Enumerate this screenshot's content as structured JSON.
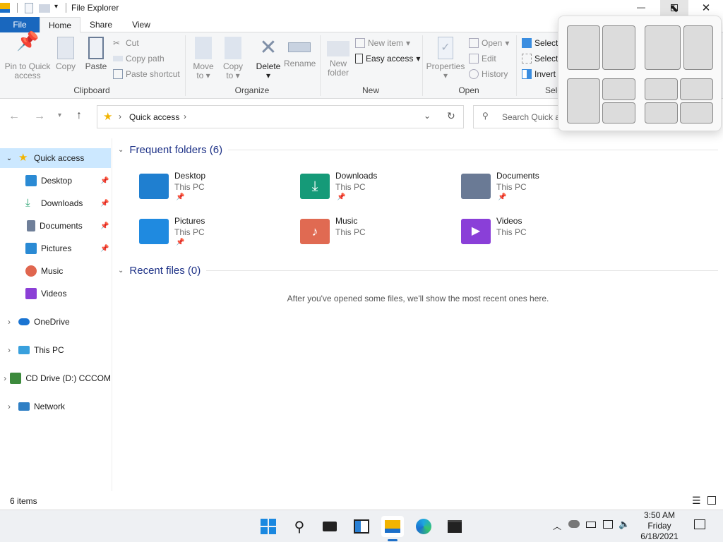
{
  "window": {
    "title": "File Explorer"
  },
  "tabs": {
    "file": "File",
    "home": "Home",
    "share": "Share",
    "view": "View"
  },
  "ribbon": {
    "clipboard": {
      "label": "Clipboard",
      "pin": "Pin to Quick access",
      "pin1": "Pin to Quick",
      "pin2": "access",
      "copy": "Copy",
      "paste": "Paste",
      "cut": "Cut",
      "copy_path": "Copy path",
      "paste_shortcut": "Paste shortcut"
    },
    "organize": {
      "label": "Organize",
      "move1": "Move",
      "move2": "to",
      "copy1": "Copy",
      "copy2": "to",
      "delete": "Delete",
      "rename": "Rename"
    },
    "new": {
      "label": "New",
      "new_folder1": "New",
      "new_folder2": "folder",
      "new_item": "New item",
      "easy_access": "Easy access"
    },
    "open": {
      "label": "Open",
      "properties": "Properties",
      "open": "Open",
      "edit": "Edit",
      "history": "History"
    },
    "select": {
      "label": "Sele",
      "select_all": "Select",
      "select_none": "Select",
      "invert": "Invert"
    }
  },
  "address": {
    "path": "Quick access",
    "search_placeholder": "Search Quick a"
  },
  "nav": {
    "items": [
      {
        "label": "Quick access",
        "color": "#f2b400"
      },
      {
        "label": "Desktop",
        "color": "#2a8ad4",
        "pinned": true
      },
      {
        "label": "Downloads",
        "color": "#1e9e6a",
        "pinned": true
      },
      {
        "label": "Documents",
        "color": "#6f7f99",
        "pinned": true
      },
      {
        "label": "Pictures",
        "color": "#2a8ad4",
        "pinned": true
      },
      {
        "label": "Music",
        "color": "#e0664f"
      },
      {
        "label": "Videos",
        "color": "#8b3fd6"
      },
      {
        "label": "OneDrive",
        "color": "#1a74d2"
      },
      {
        "label": "This PC",
        "color": "#39a0dd"
      },
      {
        "label": "CD Drive (D:) CCCOM",
        "color": "#3c8a3c"
      },
      {
        "label": "Network",
        "color": "#2f7fc4"
      }
    ]
  },
  "content": {
    "frequent_title": "Frequent folders (6)",
    "folders": [
      {
        "name": "Desktop",
        "location": "This PC",
        "color": "#1f7fd0"
      },
      {
        "name": "Downloads",
        "location": "This PC",
        "color": "#159a78"
      },
      {
        "name": "Documents",
        "location": "This PC",
        "color": "#6a7a95"
      },
      {
        "name": "Pictures",
        "location": "This PC",
        "color": "#1f8ae0"
      },
      {
        "name": "Music",
        "location": "This PC",
        "color": "#e06a52"
      },
      {
        "name": "Videos",
        "location": "This PC",
        "color": "#8a3fd8"
      }
    ],
    "recent_title": "Recent files (0)",
    "recent_empty": "After you've opened some files, we'll show the most recent ones here."
  },
  "status": {
    "items": "6 items"
  },
  "taskbar": {
    "time": "3:50 AM",
    "day": "Friday",
    "date": "6/18/2021"
  }
}
